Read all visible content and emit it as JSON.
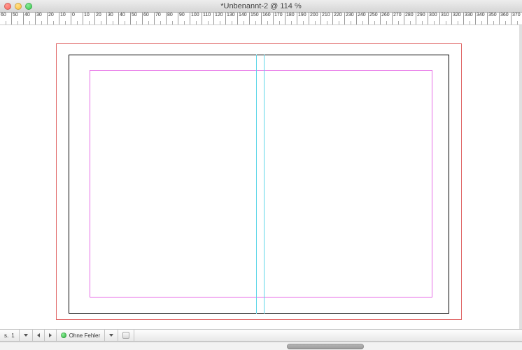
{
  "window": {
    "title": "*Unbenannt-2 @ 114 %"
  },
  "ruler": {
    "ticks": [
      "60",
      "50",
      "40",
      "30",
      "20",
      "10",
      "0",
      "10",
      "20",
      "30",
      "40",
      "50",
      "60",
      "70",
      "80",
      "90",
      "100",
      "110",
      "120",
      "130",
      "140",
      "150",
      "160",
      "170",
      "180",
      "190",
      "200",
      "210",
      "220",
      "230",
      "240",
      "250",
      "260",
      "270",
      "280",
      "290",
      "300",
      "310",
      "320",
      "330",
      "340",
      "350",
      "360",
      "370"
    ]
  },
  "status": {
    "page_label": "1",
    "preflight_label": "Ohne Fehler"
  },
  "colors": {
    "bleed": "#e06666",
    "page_frame": "#000000",
    "margin": "#e66be6",
    "guide": "#5ed6e8"
  }
}
